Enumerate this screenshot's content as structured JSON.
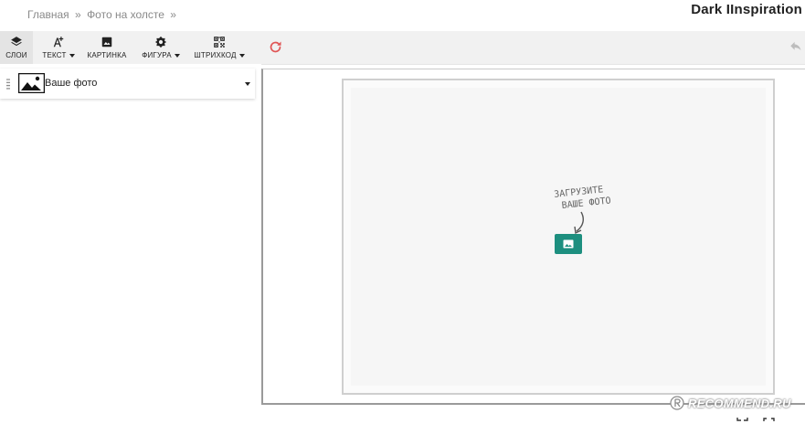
{
  "breadcrumb": {
    "home": "Главная",
    "sep1": "»",
    "current": "Фото на холсте",
    "sep2": "»"
  },
  "brand": {
    "name": "Dark IInspiration"
  },
  "toolbar": {
    "layers": {
      "label": "СЛОИ",
      "icon": "layers-icon"
    },
    "text": {
      "label": "ТЕКСТ",
      "icon": "add-text-icon"
    },
    "picture": {
      "label": "КАРТИНКА",
      "icon": "image-icon"
    },
    "shape": {
      "label": "ФИГУРА",
      "icon": "shape-icon"
    },
    "barcode": {
      "label": "ШТРИХКОД",
      "icon": "qr-code-icon"
    },
    "refresh_icon": "refresh-icon",
    "undo_icon": "undo-icon"
  },
  "layers": [
    {
      "label": "Ваше фото",
      "icon": "image-icon"
    }
  ],
  "canvas": {
    "upload_hint_line1": "ЗАГРУЗИТЕ",
    "upload_hint_line2": "ВАШЕ ФОТО",
    "upload_button_icon": "image-icon"
  },
  "watermark": {
    "text": "RECOMMEND.RU"
  },
  "colors": {
    "accent": "#1d8f7f",
    "refresh": "#e05555",
    "toolbar_bg": "#f1f1f1"
  }
}
